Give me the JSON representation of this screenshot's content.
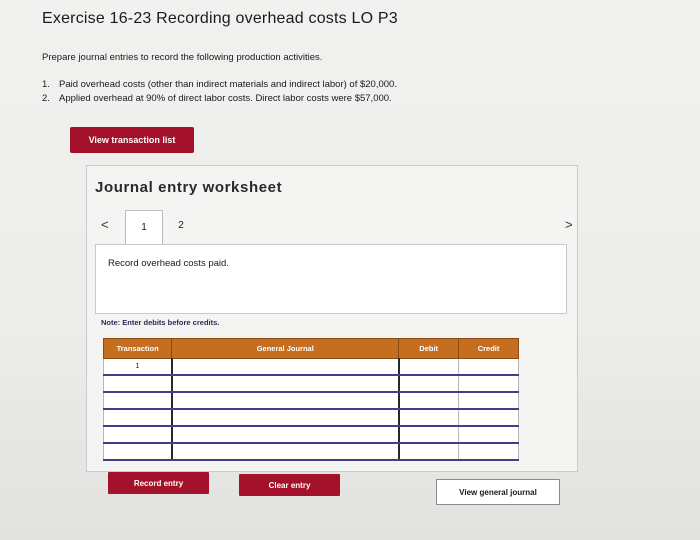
{
  "header": {
    "title": "Exercise 16-23 Recording overhead costs LO P3"
  },
  "instructions": {
    "intro": "Prepare journal entries to record the following production activities.",
    "items": [
      {
        "num": "1.",
        "text": "Paid overhead costs (other than indirect materials and indirect labor) of $20,000."
      },
      {
        "num": "2.",
        "text": "Applied overhead at 90% of direct labor costs. Direct labor costs were $57,000."
      }
    ]
  },
  "buttons": {
    "view_transaction_list": "View transaction list",
    "record_entry": "Record entry",
    "clear_entry": "Clear entry",
    "view_general_journal": "View general journal"
  },
  "worksheet": {
    "title": "Journal entry worksheet",
    "prev_glyph": "<",
    "next_glyph": ">",
    "tabs": [
      "1",
      "2"
    ],
    "active_tab": "1",
    "entry_description": "Record overhead costs paid.",
    "note": "Note: Enter debits before credits.",
    "columns": {
      "transaction": "Transaction",
      "general_journal": "General Journal",
      "debit": "Debit",
      "credit": "Credit"
    },
    "rows": [
      {
        "transaction": "1",
        "account": "",
        "debit": "",
        "credit": ""
      },
      {
        "transaction": "",
        "account": "",
        "debit": "",
        "credit": ""
      },
      {
        "transaction": "",
        "account": "",
        "debit": "",
        "credit": ""
      },
      {
        "transaction": "",
        "account": "",
        "debit": "",
        "credit": ""
      },
      {
        "transaction": "",
        "account": "",
        "debit": "",
        "credit": ""
      },
      {
        "transaction": "",
        "account": "",
        "debit": "",
        "credit": ""
      }
    ]
  },
  "colors": {
    "brand_red": "#a3122a",
    "table_header": "#c66e1f"
  }
}
